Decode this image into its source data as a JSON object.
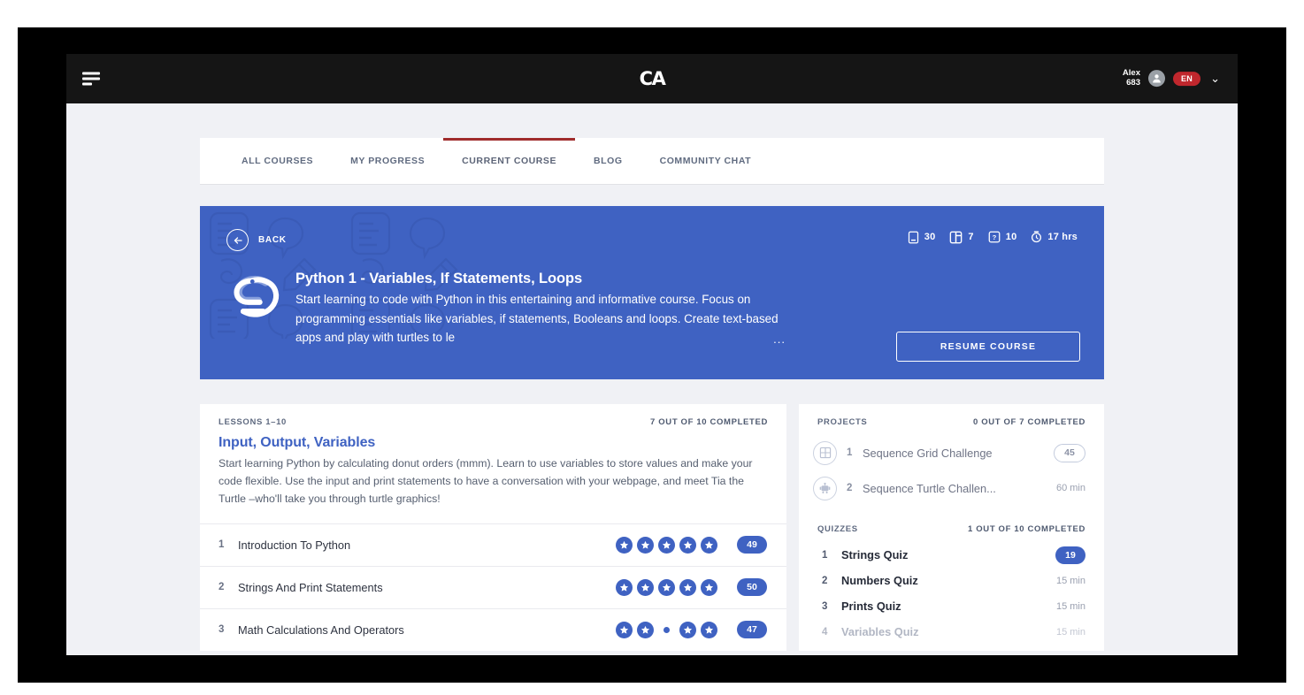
{
  "topbar": {
    "menu_icon": "hamburger-icon",
    "brand": "CA",
    "user": {
      "name": "Alex",
      "points": "683"
    },
    "language": "EN",
    "caret_icon": "chevron-down-icon"
  },
  "nav": {
    "tabs": [
      {
        "label": "ALL COURSES",
        "active": false
      },
      {
        "label": "MY PROGRESS",
        "active": false
      },
      {
        "label": "CURRENT COURSE",
        "active": true
      },
      {
        "label": "BLOG",
        "active": false
      },
      {
        "label": "COMMUNITY CHAT",
        "active": false
      }
    ]
  },
  "hero": {
    "back_label": "BACK",
    "back_icon": "arrow-left-icon",
    "stats": [
      {
        "icon": "book-icon",
        "value": "30"
      },
      {
        "icon": "cards-icon",
        "value": "7"
      },
      {
        "icon": "question-icon",
        "value": "10"
      },
      {
        "icon": "clock-icon",
        "value": "17 hrs"
      }
    ],
    "course_icon": "python-snake-icon",
    "title": "Python 1 - Variables, If Statements, Loops",
    "description": "Start learning to code with Python in this entertaining and informative course. Focus on programming essentials like variables, if statements, Booleans and loops. Create text-based apps and play with turtles to le",
    "ellipsis": "...",
    "resume_label": "RESUME COURSE",
    "accent_color": "#3f62c2"
  },
  "lessons": {
    "section_label": "LESSONS 1–10",
    "progress_label": "7 OUT OF 10 COMPLETED",
    "intro_title": "Input, Output, Variables",
    "intro_text": "Start learning Python by calculating donut orders (mmm). Learn to use variables to store values and make your code flexible. Use the input and print statements to have a conversation with your webpage, and meet Tia the Turtle –who'll take you through turtle graphics!",
    "rows": [
      {
        "num": "1",
        "name": "Introduction To Python",
        "stars": [
          "star",
          "star",
          "star",
          "star",
          "star"
        ],
        "score": "49"
      },
      {
        "num": "2",
        "name": "Strings And Print Statements",
        "stars": [
          "star",
          "star",
          "star",
          "star",
          "star"
        ],
        "score": "50"
      },
      {
        "num": "3",
        "name": "Math Calculations And Operators",
        "stars": [
          "star",
          "star",
          "dot",
          "star",
          "star"
        ],
        "score": "47"
      }
    ]
  },
  "projects": {
    "section_label": "PROJECTS",
    "progress_label": "0 OUT OF 7 COMPLETED",
    "rows": [
      {
        "icon": "grid-icon",
        "num": "1",
        "name": "Sequence Grid Challenge",
        "pill": "45",
        "time": null
      },
      {
        "icon": "robot-icon",
        "num": "2",
        "name": "Sequence Turtle Challen...",
        "pill": null,
        "time": "60 min"
      }
    ]
  },
  "quizzes": {
    "section_label": "QUIZZES",
    "progress_label": "1 OUT OF 10 COMPLETED",
    "rows": [
      {
        "num": "1",
        "name": "Strings Quiz",
        "pill": "19",
        "time": null,
        "dim": false
      },
      {
        "num": "2",
        "name": "Numbers Quiz",
        "pill": null,
        "time": "15 min",
        "dim": false
      },
      {
        "num": "3",
        "name": "Prints Quiz",
        "pill": null,
        "time": "15 min",
        "dim": false
      },
      {
        "num": "4",
        "name": "Variables Quiz",
        "pill": null,
        "time": "15 min",
        "dim": true
      }
    ]
  }
}
